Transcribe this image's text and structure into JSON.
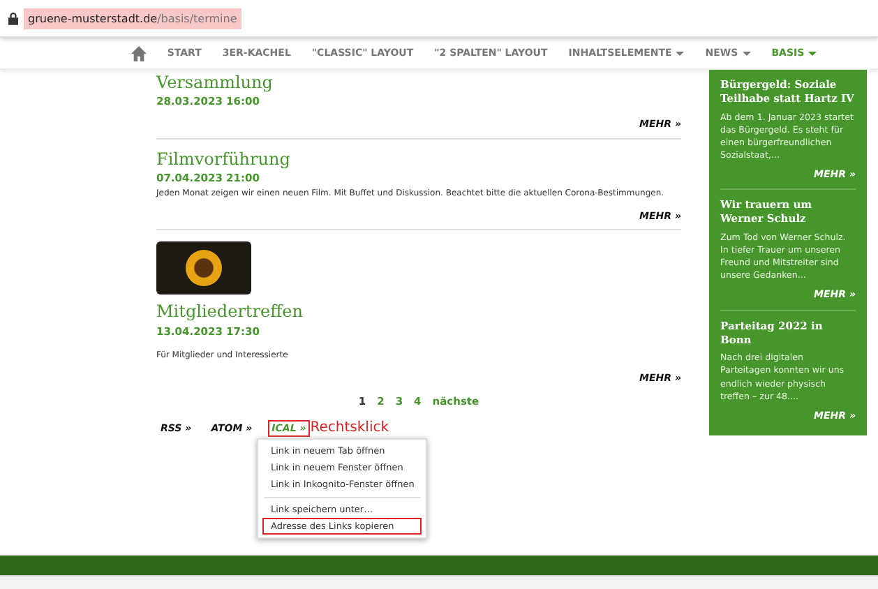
{
  "address_bar": {
    "domain": "gruene-musterstadt.de",
    "path": "/basis/termine"
  },
  "nav": [
    {
      "label": "START",
      "dropdown": false,
      "selected": false
    },
    {
      "label": "3ER-KACHEL",
      "dropdown": false,
      "selected": false
    },
    {
      "label": "\"CLASSIC\" LAYOUT",
      "dropdown": false,
      "selected": false
    },
    {
      "label": "\"2 SPALTEN\" LAYOUT",
      "dropdown": false,
      "selected": false
    },
    {
      "label": "INHALTSELEMENTE",
      "dropdown": true,
      "selected": false
    },
    {
      "label": "NEWS",
      "dropdown": true,
      "selected": false
    },
    {
      "label": "BASIS",
      "dropdown": true,
      "selected": true
    }
  ],
  "events": [
    {
      "title": "Versammlung",
      "date": "28.03.2023 16:00",
      "more": "MEHR »",
      "image": false
    },
    {
      "title": "Filmvorführung",
      "date": "07.04.2023 21:00",
      "text": "Jeden Monat zeigen wir einen neuen Film. Mit Buffet und Diskussion. Beachtet bitte die aktuellen Corona-Bestimmungen.",
      "more": "MEHR »",
      "image": false
    },
    {
      "title": "Mitgliedertreffen",
      "date": "13.04.2023 17:30",
      "text": "Für Mitglieder und Interessierte",
      "more": "MEHR »",
      "image": true
    }
  ],
  "pagination": [
    {
      "label": "1",
      "selected": true
    },
    {
      "label": "2",
      "selected": false
    },
    {
      "label": "3",
      "selected": false
    },
    {
      "label": "4",
      "selected": false
    },
    {
      "label": "nächste",
      "selected": false
    }
  ],
  "feeds": [
    {
      "label": "RSS »",
      "highlighted": false
    },
    {
      "label": "ATOM »",
      "highlighted": false
    },
    {
      "label": "ICAL »",
      "highlighted": true
    }
  ],
  "annotation": "Rechtsklick",
  "context_menu": [
    {
      "label": "Link in neuem Tab öffnen",
      "highlighted": false,
      "separator_before": false
    },
    {
      "label": "Link in neuem Fenster öffnen",
      "highlighted": false,
      "separator_before": false
    },
    {
      "label": "Link in Inkognito-Fenster öffnen",
      "highlighted": false,
      "separator_before": false
    },
    {
      "label": "Link speichern unter…",
      "highlighted": false,
      "separator_before": true
    },
    {
      "label": "Adresse des Links kopieren",
      "highlighted": true,
      "separator_before": false
    }
  ],
  "sidebar": [
    {
      "title": "Bürgergeld: Soziale Teilhabe statt Hartz IV",
      "text": "Ab dem 1. Januar 2023 startet das Bürgergeld. Es steht für einen bürgerfreundlichen Sozialstaat,...",
      "more": "MEHR »"
    },
    {
      "title": "Wir trauern um Werner Schulz",
      "text": "Zum Tod von Werner Schulz. In tiefer Trauer um unseren Freund und Mitstreiter sind unsere Gedanken...",
      "more": "MEHR »"
    },
    {
      "title": "Parteitag 2022 in Bonn",
      "text": "Nach drei digitalen Parteitagen konnten wir uns endlich wieder physisch treffen – zur 48....",
      "more": "MEHR »"
    }
  ]
}
